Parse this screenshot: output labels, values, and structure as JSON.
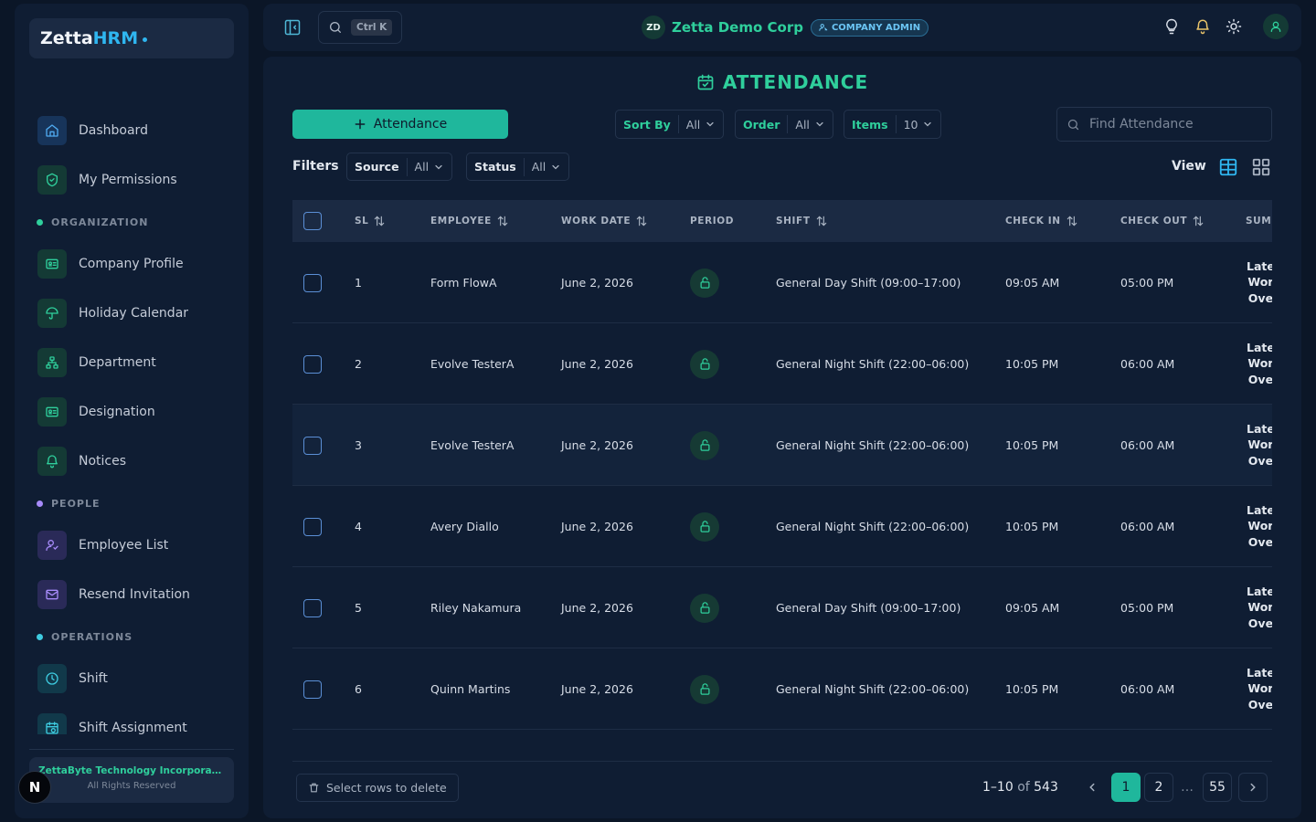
{
  "brand": {
    "name_part1": "Zetta",
    "name_part2": "HRM"
  },
  "sidebar": {
    "items_top": [
      {
        "label": "Dashboard",
        "icon": "home-icon"
      },
      {
        "label": "My Permissions",
        "icon": "shield-check-icon"
      }
    ],
    "sections": [
      {
        "title": "ORGANIZATION",
        "color": "#2fcf9c",
        "items": [
          {
            "label": "Company Profile",
            "icon": "id-card-icon"
          },
          {
            "label": "Holiday Calendar",
            "icon": "umbrella-icon"
          },
          {
            "label": "Department",
            "icon": "org-chart-icon"
          },
          {
            "label": "Designation",
            "icon": "id-card-icon"
          },
          {
            "label": "Notices",
            "icon": "bell-icon"
          }
        ]
      },
      {
        "title": "PEOPLE",
        "color": "#a78bfa",
        "items": [
          {
            "label": "Employee List",
            "icon": "user-icon"
          },
          {
            "label": "Resend Invitation",
            "icon": "mail-icon"
          }
        ]
      },
      {
        "title": "OPERATIONS",
        "color": "#3ecbe0",
        "items": [
          {
            "label": "Shift",
            "icon": "clock-icon"
          },
          {
            "label": "Shift Assignment",
            "icon": "calendar-clock-icon"
          }
        ]
      }
    ],
    "footer": {
      "company": "ZettaByte Technology Incorporat...",
      "rights": "All Rights Reserved"
    },
    "badge": "N"
  },
  "topbar": {
    "search_shortcut": "Ctrl K",
    "company_initials": "ZD",
    "company_name": "Zetta Demo Corp",
    "role": "COMPANY ADMIN"
  },
  "page": {
    "title": "ATTENDANCE",
    "add_button": "Attendance",
    "sort_by": {
      "label": "Sort By",
      "value": "All"
    },
    "order": {
      "label": "Order",
      "value": "All"
    },
    "items": {
      "label": "Items",
      "value": "10"
    },
    "search_placeholder": "Find Attendance",
    "filters_label": "Filters",
    "source": {
      "label": "Source",
      "value": "All"
    },
    "status": {
      "label": "Status",
      "value": "All"
    },
    "view_label": "View"
  },
  "table": {
    "columns": [
      "SL",
      "EMPLOYEE",
      "WORK DATE",
      "PERIOD",
      "SHIFT",
      "CHECK IN",
      "CHECK OUT",
      "SUMMARY"
    ],
    "summary_labels": [
      "Late",
      "Wor",
      "Ove"
    ],
    "rows": [
      {
        "sl": "1",
        "employee": "Form FlowA",
        "date": "June 2, 2026",
        "shift": "General Day Shift (09:00–17:00)",
        "check_in": "09:05 AM",
        "check_out": "05:00 PM"
      },
      {
        "sl": "2",
        "employee": "Evolve TesterA",
        "date": "June 2, 2026",
        "shift": "General Night Shift (22:00–06:00)",
        "check_in": "10:05 PM",
        "check_out": "06:00 AM"
      },
      {
        "sl": "3",
        "employee": "Evolve TesterA",
        "date": "June 2, 2026",
        "shift": "General Night Shift (22:00–06:00)",
        "check_in": "10:05 PM",
        "check_out": "06:00 AM"
      },
      {
        "sl": "4",
        "employee": "Avery Diallo",
        "date": "June 2, 2026",
        "shift": "General Night Shift (22:00–06:00)",
        "check_in": "10:05 PM",
        "check_out": "06:00 AM"
      },
      {
        "sl": "5",
        "employee": "Riley Nakamura",
        "date": "June 2, 2026",
        "shift": "General Day Shift (09:00–17:00)",
        "check_in": "09:05 AM",
        "check_out": "05:00 PM"
      },
      {
        "sl": "6",
        "employee": "Quinn Martins",
        "date": "June 2, 2026",
        "shift": "General Night Shift (22:00–06:00)",
        "check_in": "10:05 PM",
        "check_out": "06:00 AM"
      }
    ]
  },
  "footer": {
    "delete_label": "Select rows to delete",
    "range": "1–10",
    "of": "of",
    "total": "543",
    "pages": [
      "1",
      "2",
      "…",
      "55"
    ]
  },
  "colors": {
    "accent": "#1fb79c",
    "brand_blue": "#2fb6f0",
    "bg": "#0b1627",
    "panel": "#0f1d33"
  }
}
